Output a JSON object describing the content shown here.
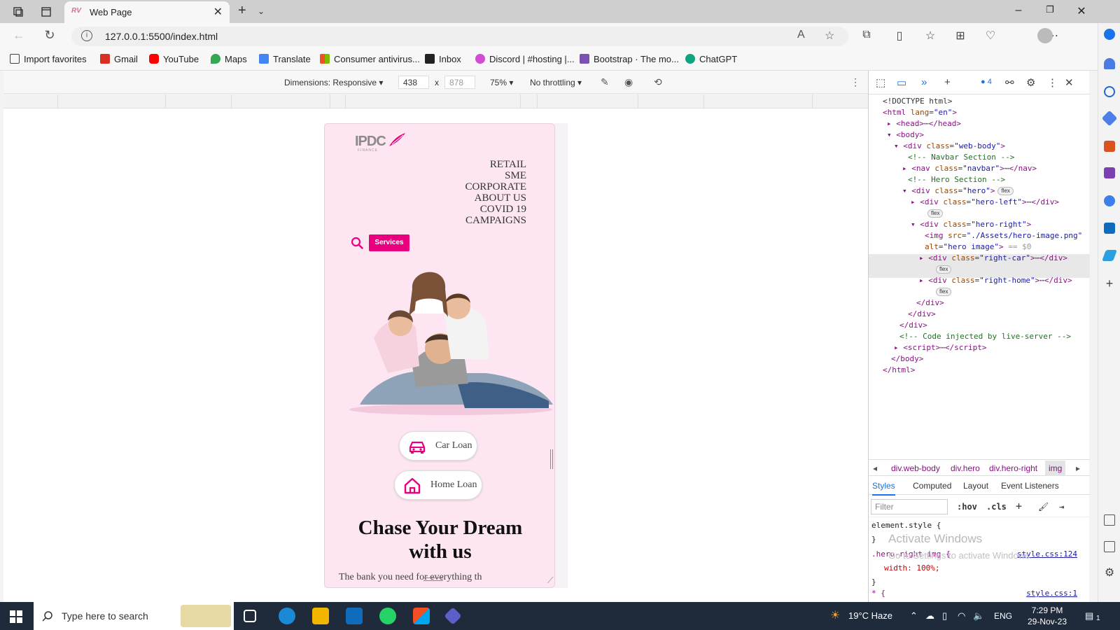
{
  "browser": {
    "tab_title": "Web Page",
    "url": "127.0.0.1:5500/index.html",
    "favorites": [
      {
        "label": "Import favorites",
        "icon": "import-icon",
        "color": "#444444"
      },
      {
        "label": "Gmail",
        "icon": "gmail-icon",
        "color": "#d93025"
      },
      {
        "label": "YouTube",
        "icon": "youtube-icon",
        "color": "#ff0000"
      },
      {
        "label": "Maps",
        "icon": "maps-icon",
        "color": "#34a853"
      },
      {
        "label": "Translate",
        "icon": "translate-icon",
        "color": "#4285f4"
      },
      {
        "label": "Consumer antivirus...",
        "icon": "microsoft-icon",
        "color": "#f25022"
      },
      {
        "label": "Inbox",
        "icon": "inbox-icon",
        "color": "#222222"
      },
      {
        "label": "Discord | #hosting |...",
        "icon": "discord-icon",
        "color": "#d14bd3"
      },
      {
        "label": "Bootstrap · The mo...",
        "icon": "bootstrap-icon",
        "color": "#7952b3"
      },
      {
        "label": "ChatGPT",
        "icon": "chatgpt-icon",
        "color": "#10a37f"
      }
    ]
  },
  "device_toolbar": {
    "dimensions_label": "Dimensions: Responsive",
    "width": "438",
    "separator": "x",
    "height": "878",
    "zoom": "75%",
    "throttling": "No throttling"
  },
  "page": {
    "logo_text": "IPDC",
    "logo_sub": "FINANCE",
    "nav_links": [
      "RETAIL",
      "SME",
      "CORPORATE",
      "ABOUT US",
      "COVID 19",
      "CAMPAIGNS"
    ],
    "services_button": "Services",
    "car_loan": "Car Loan",
    "home_loan": "Home Loan",
    "hero_title_line1": "Chase Your Dream",
    "hero_title_line2": "with us",
    "hero_subtitle": "The bank you need for everything th",
    "accent_color": "#e8007e",
    "background_color": "#fde6f1"
  },
  "devtools": {
    "issues_count": "4",
    "breadcrumbs": [
      "div.web-body",
      "div.hero",
      "div.hero-right",
      "img"
    ],
    "style_tabs": [
      "Styles",
      "Computed",
      "Layout",
      "Event Listeners"
    ],
    "filter_placeholder": "Filter",
    "filter_hov": ":hov",
    "filter_cls": ".cls",
    "css": {
      "element_style": "element.style {",
      "close_brace": "}",
      "rule_selector": ".hero-right img {",
      "rule_prop": "width: 100%;",
      "rule_link": "style.css:124",
      "universal_selector": "* {",
      "universal_link": "style.css:1"
    },
    "watermark_title": "Activate Windows",
    "watermark_sub": "Go to Settings to activate Windows."
  },
  "taskbar": {
    "search_placeholder": "Type here to search",
    "weather": "19°C Haze",
    "language": "ENG",
    "time": "7:29 PM",
    "date": "29-Nov-23",
    "notification_count": "1"
  }
}
